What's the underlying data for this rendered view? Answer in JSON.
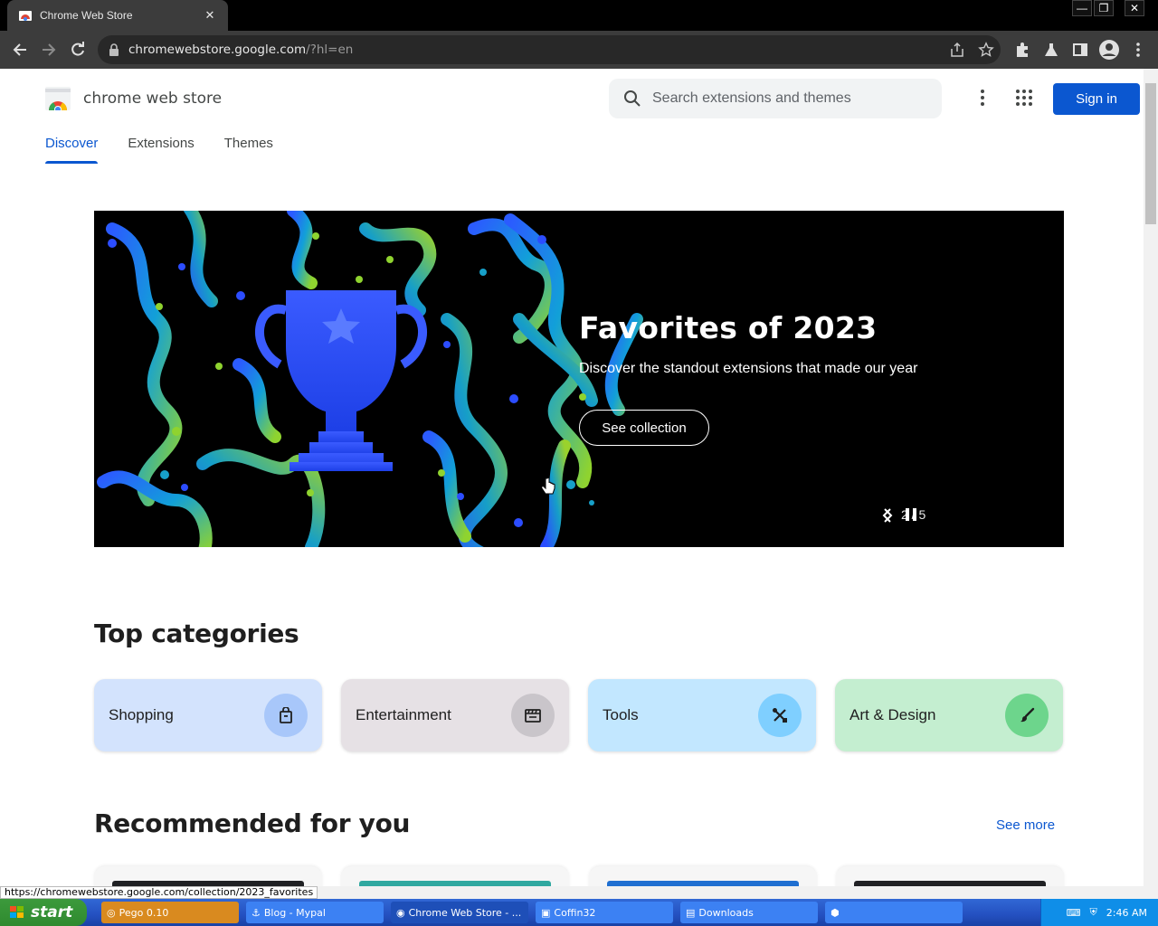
{
  "browser": {
    "tab_title": "Chrome Web Store",
    "url_host": "chromewebstore.google.com",
    "url_path": "/?hl=en"
  },
  "store": {
    "logo_text": "chrome web store",
    "search_placeholder": "Search extensions and themes",
    "sign_in": "Sign in",
    "nav": [
      {
        "label": "Discover"
      },
      {
        "label": "Extensions"
      },
      {
        "label": "Themes"
      }
    ]
  },
  "hero": {
    "title": "Favorites of 2023",
    "subtitle": "Discover the standout extensions that made our year",
    "button": "See collection",
    "page_indicator": "2 / 5"
  },
  "top_categories": {
    "heading": "Top categories",
    "items": [
      {
        "label": "Shopping",
        "bg": "#d3e3fd",
        "icon_bg": "#a8c7fa",
        "icon": "shopping-bag-icon"
      },
      {
        "label": "Entertainment",
        "bg": "#e6e1e5",
        "icon_bg": "#c9c5ca",
        "icon": "clapperboard-icon"
      },
      {
        "label": "Tools",
        "bg": "#c2e7ff",
        "icon_bg": "#7fcfff",
        "icon": "tools-icon"
      },
      {
        "label": "Art & Design",
        "bg": "#c4eed0",
        "icon_bg": "#6dd58c",
        "icon": "brush-icon"
      }
    ]
  },
  "recommended": {
    "heading": "Recommended for you",
    "see_more": "See more"
  },
  "status_url": "https://chromewebstore.google.com/collection/2023_favorites",
  "taskbar": {
    "start": "start",
    "tasks": [
      {
        "label": "Pego 0.10"
      },
      {
        "label": "Blog - Mypal"
      },
      {
        "label": "Chrome Web Store - ..."
      },
      {
        "label": "Coffin32"
      },
      {
        "label": "Downloads"
      }
    ],
    "clock": "2:46 AM"
  }
}
